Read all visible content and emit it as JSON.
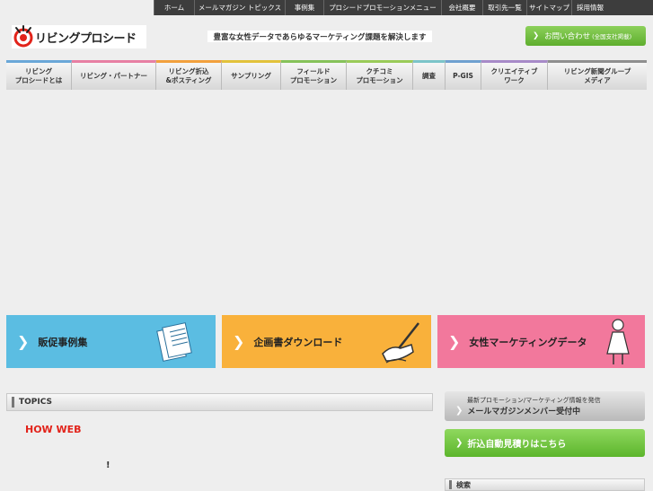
{
  "top_nav": [
    "ホーム",
    "メールマガジン トピックス",
    "事例集",
    "プロシードプロモーションメニュー",
    "会社概要",
    "取引先一覧",
    "サイトマップ",
    "採用情報"
  ],
  "logo": {
    "text": "リビングプロシード"
  },
  "tagline": "豊富な女性データであらゆるマーケティング課題を解決します",
  "contact": {
    "label": "お問い合わせ",
    "note": "(全国支社掲載)"
  },
  "main_nav": [
    {
      "line1": "リビング",
      "line2": "プロシードとは",
      "color": "#6aa7d8"
    },
    {
      "line1": "リビング・パートナー",
      "line2": "",
      "color": "#e77fa3"
    },
    {
      "line1": "リビング折込",
      "line2": "&ポスティング",
      "color": "#f2a03d"
    },
    {
      "line1": "サンプリング",
      "line2": "",
      "color": "#e2c23b"
    },
    {
      "line1": "フィールド",
      "line2": "プロモーション",
      "color": "#86c25a"
    },
    {
      "line1": "クチコミ",
      "line2": "プロモーション",
      "color": "#9acb59"
    },
    {
      "line1": "調査",
      "line2": "",
      "color": "#7cc4c9"
    },
    {
      "line1": "P-GIS",
      "line2": "",
      "color": "#6fa0d0"
    },
    {
      "line1": "クリエイティブ",
      "line2": "ワーク",
      "color": "#a78ac8"
    },
    {
      "line1": "リビング新聞グループ",
      "line2": "メディア",
      "color": "#8f8f8f"
    }
  ],
  "banners": [
    {
      "label": "販促事例集",
      "color": "#5bbde2",
      "icon": "documents-icon"
    },
    {
      "label": "企画書ダウンロード",
      "color": "#f9b13b",
      "icon": "hand-writing-icon"
    },
    {
      "label": "女性マーケティングデータ",
      "color": "#f2789c",
      "icon": "woman-icon"
    }
  ],
  "topics": {
    "heading": "TOPICS",
    "item": "HOW  WEB",
    "excl": "!"
  },
  "sidebar": {
    "mail_small": "最新プロモーション/マーケティング情報を発信",
    "mail_large": "メールマガジンメンバー受付中",
    "estimate": "折込自動見積りはこちら",
    "search": "検索"
  }
}
